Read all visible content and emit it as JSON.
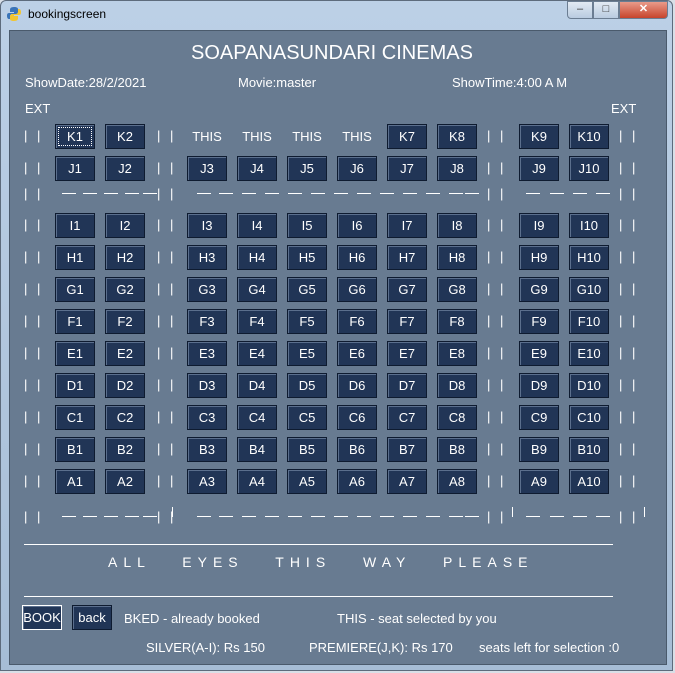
{
  "window": {
    "title": "bookingscreen",
    "controls": {
      "minimize": "–",
      "maximize": "□",
      "close": "✕"
    }
  },
  "header": {
    "cinema_name": "SOAPANASUNDARI CINEMAS",
    "show_date": "ShowDate:28/2/2021",
    "movie": "Movie:master",
    "show_time": "ShowTime:4:00 A M",
    "exit_left": "EXT",
    "exit_right": "EXT"
  },
  "rows": [
    {
      "seats": [
        "K1",
        "K2",
        "THIS",
        "THIS",
        "THIS",
        "THIS",
        "K7",
        "K8",
        "K9",
        "K10"
      ]
    },
    {
      "seats": [
        "J1",
        "J2",
        "J3",
        "J4",
        "J5",
        "J6",
        "J7",
        "J8",
        "J9",
        "J10"
      ]
    },
    {
      "seats": [
        "I1",
        "I2",
        "I3",
        "I4",
        "I5",
        "I6",
        "I7",
        "I8",
        "I9",
        "I10"
      ]
    },
    {
      "seats": [
        "H1",
        "H2",
        "H3",
        "H4",
        "H5",
        "H6",
        "H7",
        "H8",
        "H9",
        "H10"
      ]
    },
    {
      "seats": [
        "G1",
        "G2",
        "G3",
        "G4",
        "G5",
        "G6",
        "G7",
        "G8",
        "G9",
        "G10"
      ]
    },
    {
      "seats": [
        "F1",
        "F2",
        "F3",
        "F4",
        "F5",
        "F6",
        "F7",
        "F8",
        "F9",
        "F10"
      ]
    },
    {
      "seats": [
        "E1",
        "E2",
        "E3",
        "E4",
        "E5",
        "E6",
        "E7",
        "E8",
        "E9",
        "E10"
      ]
    },
    {
      "seats": [
        "D1",
        "D2",
        "D3",
        "D4",
        "D5",
        "D6",
        "D7",
        "D8",
        "D9",
        "D10"
      ]
    },
    {
      "seats": [
        "C1",
        "C2",
        "C3",
        "C4",
        "C5",
        "C6",
        "C7",
        "C8",
        "C9",
        "C10"
      ]
    },
    {
      "seats": [
        "B1",
        "B2",
        "B3",
        "B4",
        "B5",
        "B6",
        "B7",
        "B8",
        "B9",
        "B10"
      ]
    },
    {
      "seats": [
        "A1",
        "A2",
        "A3",
        "A4",
        "A5",
        "A6",
        "A7",
        "A8",
        "A9",
        "A10"
      ]
    }
  ],
  "separator_char": "|",
  "screen_text": "ALL EYES THIS WAY PLEASE",
  "footer": {
    "book_button": "BOOK",
    "back_button": "back",
    "legend_booked": "BKED  - already booked",
    "legend_selected": "THIS   -  seat selected by you",
    "price_silver": "SILVER(A-I): Rs 150",
    "price_premiere": "PREMIERE(J,K): Rs 170",
    "seats_left": "seats left for selection :0"
  }
}
